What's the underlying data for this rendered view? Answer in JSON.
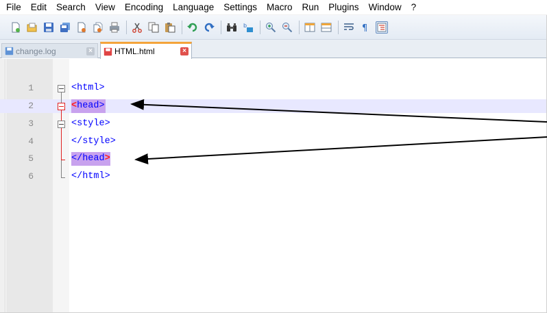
{
  "menu": {
    "items": [
      "File",
      "Edit",
      "Search",
      "View",
      "Encoding",
      "Language",
      "Settings",
      "Macro",
      "Run",
      "Plugins",
      "Window",
      "?"
    ]
  },
  "toolbar": {
    "buttons": [
      "new-file-icon",
      "open-file-icon",
      "save-icon",
      "save-all-icon",
      "close-icon",
      "close-all-icon",
      "print-icon",
      "cut-icon",
      "copy-icon",
      "paste-icon",
      "undo-icon",
      "redo-icon",
      "find-icon",
      "replace-icon",
      "zoom-in-icon",
      "zoom-out-icon",
      "sync-vertical-icon",
      "sync-horizontal-icon",
      "word-wrap-icon",
      "show-all-chars-icon",
      "indent-guide-icon"
    ]
  },
  "tabs": [
    {
      "label": "change.log",
      "active": false
    },
    {
      "label": "HTML.html",
      "active": true
    }
  ],
  "editor": {
    "lines": [
      {
        "number": "1",
        "text": "<html>"
      },
      {
        "number": "2",
        "text": "<head>"
      },
      {
        "number": "3",
        "text": "<style>"
      },
      {
        "number": "4",
        "text": "</style>"
      },
      {
        "number": "5",
        "text": "</head>"
      },
      {
        "number": "6",
        "text": "</html>"
      }
    ],
    "current_line": 2
  },
  "colors": {
    "tag": "#0000ff",
    "match_highlight": "#c8a2ee",
    "bracket_highlight": "#ff1f1f",
    "current_line": "#e8e8ff",
    "active_tab_accent": "#f4a43a"
  }
}
